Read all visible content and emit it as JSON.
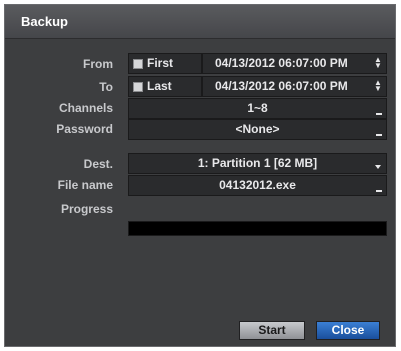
{
  "window": {
    "title": "Backup"
  },
  "labels": {
    "from": "From",
    "to": "To",
    "channels": "Channels",
    "password": "Password",
    "dest": "Dest.",
    "file_name": "File name",
    "progress": "Progress"
  },
  "from": {
    "checkbox_label": "First",
    "datetime": "04/13/2012  06:07:00 PM"
  },
  "to": {
    "checkbox_label": "Last",
    "datetime": "04/13/2012  06:07:00 PM"
  },
  "channels": {
    "value": "1~8"
  },
  "password": {
    "value": "<None>"
  },
  "dest": {
    "value": "1: Partition 1 [62 MB]"
  },
  "file_name": {
    "value": "04132012.exe"
  },
  "buttons": {
    "start": "Start",
    "close": "Close"
  },
  "colors": {
    "panel": "#3d3e40",
    "field": "#2a2b2d",
    "close_button": "#2a64b8"
  }
}
